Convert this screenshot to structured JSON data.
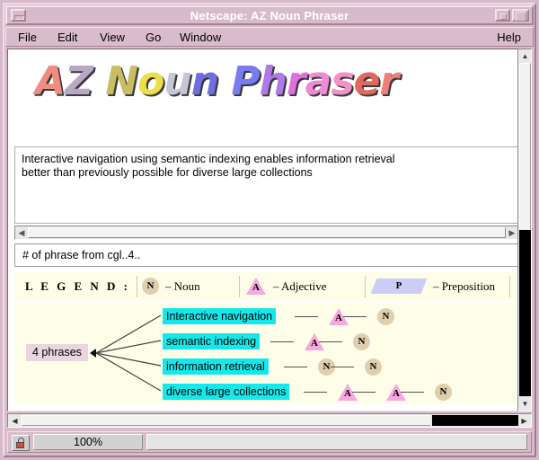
{
  "window": {
    "title": "Netscape: AZ Noun Phraser",
    "minimize_label": "minimize",
    "restore_label": "restore",
    "maximize_label": "maximize"
  },
  "menubar": {
    "items": [
      {
        "label": "File"
      },
      {
        "label": "Edit"
      },
      {
        "label": "View"
      },
      {
        "label": "Go"
      },
      {
        "label": "Window"
      }
    ],
    "help_label": "Help"
  },
  "logo": {
    "text": "AZ Noun Phraser",
    "letters": [
      {
        "char": "A",
        "color": "#f08c82"
      },
      {
        "char": "Z",
        "color": "#b9a8c4"
      },
      {
        "char": " ",
        "color": "#ffffff"
      },
      {
        "char": "N",
        "color": "#c9bc63"
      },
      {
        "char": "o",
        "color": "#ece04a"
      },
      {
        "char": "u",
        "color": "#c6c6d6"
      },
      {
        "char": "n",
        "color": "#6d6fe0"
      },
      {
        "char": " ",
        "color": "#ffffff"
      },
      {
        "char": "P",
        "color": "#7b7bf0"
      },
      {
        "char": "h",
        "color": "#b178e8"
      },
      {
        "char": "r",
        "color": "#e06fe0"
      },
      {
        "char": "a",
        "color": "#ef8ad4"
      },
      {
        "char": "s",
        "color": "#f292c8"
      },
      {
        "char": "e",
        "color": "#e2675f"
      },
      {
        "char": "r",
        "color": "#ee8177"
      }
    ]
  },
  "description": {
    "line1": "Interactive navigation using semantic indexing enables information retrieval",
    "line2": "better than previously possible for diverse large collections"
  },
  "query": {
    "value": "# of phrase from cgl..4..",
    "placeholder": "# of phrase from cgl..4.."
  },
  "legend": {
    "title": "L E G E N D :",
    "items": [
      {
        "marker": "N",
        "shape": "circle",
        "color": "#e0cfae",
        "label": "– Noun"
      },
      {
        "marker": "A",
        "shape": "triangle",
        "color": "#f7a8de",
        "label": "– Adjective"
      },
      {
        "marker": "P",
        "shape": "parallelogram",
        "color": "#ccccf7",
        "label": "– Preposition"
      }
    ]
  },
  "tree": {
    "root_label": "4 phrases",
    "phrases": [
      {
        "text": "Interactive navigation",
        "tags": [
          "A",
          "N"
        ]
      },
      {
        "text": "semantic indexing",
        "tags": [
          "A",
          "N"
        ]
      },
      {
        "text": "information retrieval",
        "tags": [
          "N",
          "N"
        ]
      },
      {
        "text": "diverse large collections",
        "tags": [
          "A",
          "A",
          "N"
        ]
      }
    ]
  },
  "scrollbars": {
    "vertical_up": "▲",
    "vertical_down": "▼",
    "horizontal_left": "◀",
    "horizontal_right": "▶"
  },
  "statusbar": {
    "progress": "100%",
    "security_icon": "lock-icon"
  },
  "colors": {
    "frame": "#d9bccb",
    "title_text": "#ffffff",
    "phrase_box": "#15e8ea",
    "root_box": "#e9d6e0",
    "legend_bg": "#fdfde8"
  }
}
